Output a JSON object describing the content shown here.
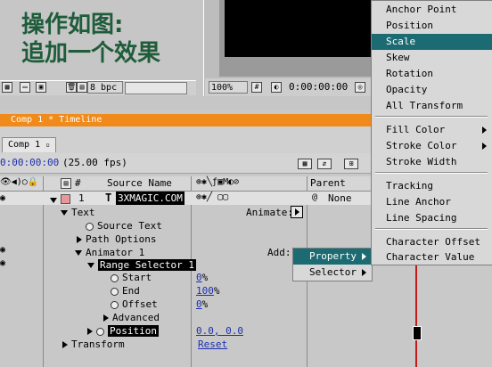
{
  "caption": {
    "line1": "操作如图:",
    "line2": "追加一个效果"
  },
  "top_toolbar": {
    "bpc": "8 bpc"
  },
  "viewer_toolbar": {
    "zoom": "100%",
    "timecode": "0:00:00:00"
  },
  "timeline": {
    "title": "Comp 1 * Timeline",
    "tab": "Comp 1",
    "timecode": "0:00:00:00",
    "fps": "(25.00 fps)",
    "columns": {
      "number": "#",
      "source_name": "Source Name",
      "parent": "Parent"
    },
    "layer": {
      "index": "1",
      "name": "3XMAGIC.COM",
      "parent": "None"
    },
    "rows": {
      "text": "Text",
      "source_text": "Source Text",
      "path_options": "Path Options",
      "animator": "Animator 1",
      "range_selector": "Range Selector 1",
      "start": "Start",
      "end": "End",
      "offset": "Offset",
      "advanced": "Advanced",
      "position": "Position",
      "transform": "Transform"
    },
    "values": {
      "start": "0",
      "start_unit": "%",
      "end": "100",
      "end_unit": "%",
      "offset": "0",
      "offset_unit": "%",
      "position": "0.0, 0.0",
      "transform": "Reset"
    },
    "animate_label": "Animate:",
    "add_label": "Add:"
  },
  "property_menu": {
    "items": [
      "Anchor Point",
      "Position",
      "Scale",
      "Skew",
      "Rotation",
      "Opacity",
      "All Transform",
      "Fill Color",
      "Stroke Color",
      "Stroke Width",
      "Tracking",
      "Line Anchor",
      "Line Spacing",
      "Character Offset",
      "Character Value"
    ],
    "highlighted": "Scale"
  },
  "add_submenu": {
    "items": [
      "Property",
      "Selector"
    ],
    "highlighted": "Property"
  },
  "colors": {
    "menu_highlight": "#1c6b72",
    "timeline_bar": "#f08a1a",
    "caption": "#1e5c3a",
    "value_blue": "#1d2fb0"
  }
}
